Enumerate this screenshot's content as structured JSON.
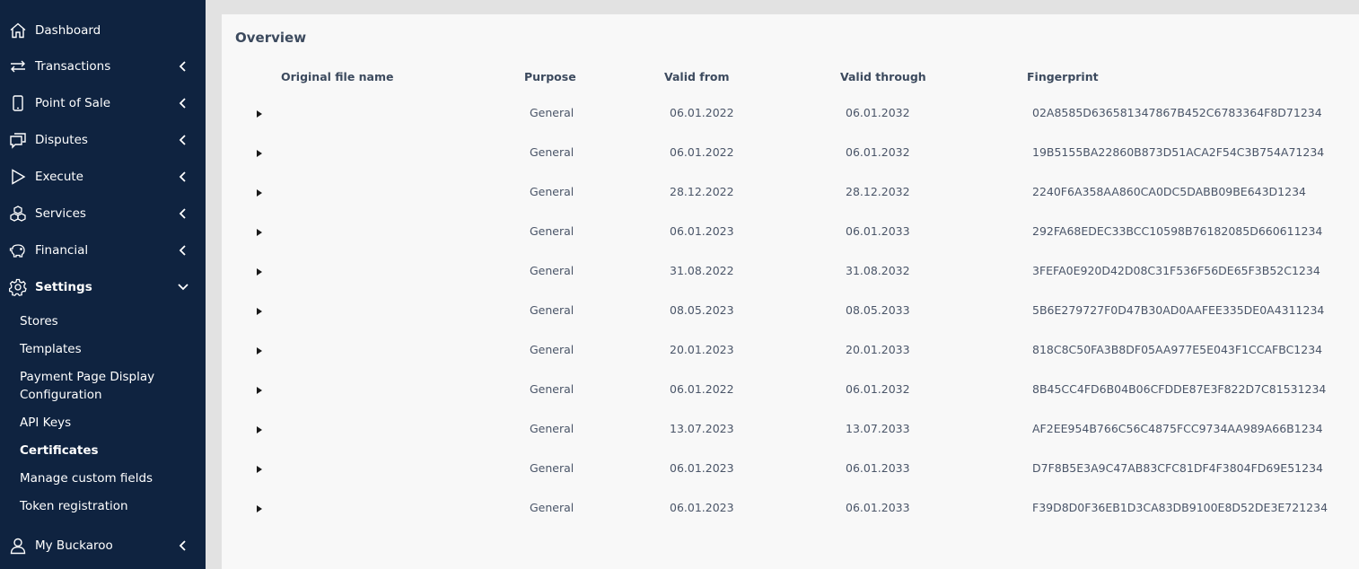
{
  "sidebar": {
    "items": [
      {
        "label": "Dashboard",
        "icon": "home-icon"
      },
      {
        "label": "Transactions",
        "icon": "transfer-arrows-icon"
      },
      {
        "label": "Point of Sale",
        "icon": "mobile-device-icon"
      },
      {
        "label": "Disputes",
        "icon": "chat-bubbles-icon"
      },
      {
        "label": "Execute",
        "icon": "play-icon"
      },
      {
        "label": "Services",
        "icon": "cubes-icon"
      },
      {
        "label": "Financial",
        "icon": "piggy-bank-icon"
      },
      {
        "label": "Settings",
        "icon": "gear-icon"
      },
      {
        "label": "My Buckaroo",
        "icon": "user-icon"
      }
    ],
    "settings_sub": [
      "Stores",
      "Templates",
      "Payment Page Display Configuration",
      "API Keys",
      "Certificates",
      "Manage custom fields",
      "Token registration"
    ],
    "active_sub": "Certificates",
    "colors": {
      "background": "#0f2340",
      "text": "#ffffff"
    }
  },
  "overview": {
    "title": "Overview",
    "columns": [
      "Original file name",
      "Purpose",
      "Valid from",
      "Valid through",
      "Fingerprint"
    ],
    "rows": [
      {
        "file": "",
        "purpose": "General",
        "from": "06.01.2022",
        "through": "06.01.2032",
        "fingerprint": "02A8585D636581347867B452C6783364F8D71234"
      },
      {
        "file": "",
        "purpose": "General",
        "from": "06.01.2022",
        "through": "06.01.2032",
        "fingerprint": "19B5155BA22860B873D51ACA2F54C3B754A71234"
      },
      {
        "file": "",
        "purpose": "General",
        "from": "28.12.2022",
        "through": "28.12.2032",
        "fingerprint": "2240F6A358AA860CA0DC5DABB09BE643D1234"
      },
      {
        "file": "",
        "purpose": "General",
        "from": "06.01.2023",
        "through": "06.01.2033",
        "fingerprint": "292FA68EDEC33BCC10598B76182085D660611234"
      },
      {
        "file": "",
        "purpose": "General",
        "from": "31.08.2022",
        "through": "31.08.2032",
        "fingerprint": "3FEFA0E920D42D08C31F536F56DE65F3B52C1234"
      },
      {
        "file": "",
        "purpose": "General",
        "from": "08.05.2023",
        "through": "08.05.2033",
        "fingerprint": "5B6E279727F0D47B30AD0AAFEE335DE0A4311234"
      },
      {
        "file": "",
        "purpose": "General",
        "from": "20.01.2023",
        "through": "20.01.2033",
        "fingerprint": "818C8C50FA3B8DF05AA977E5E043F1CCAFBC1234"
      },
      {
        "file": "",
        "purpose": "General",
        "from": "06.01.2022",
        "through": "06.01.2032",
        "fingerprint": "8B45CC4FD6B04B06CFDDE87E3F822D7C81531234"
      },
      {
        "file": "",
        "purpose": "General",
        "from": "13.07.2023",
        "through": "13.07.2033",
        "fingerprint": "AF2EE954B766C56C4875FCC9734AA989A66B1234"
      },
      {
        "file": "",
        "purpose": "General",
        "from": "06.01.2023",
        "through": "06.01.2033",
        "fingerprint": "D7F8B5E3A9C47AB83CFC81DF4F3804FD69E51234"
      },
      {
        "file": "",
        "purpose": "General",
        "from": "06.01.2023",
        "through": "06.01.2033",
        "fingerprint": "F39D8D0F36EB1D3CA83DB9100E8D52DE3E721234"
      }
    ]
  }
}
